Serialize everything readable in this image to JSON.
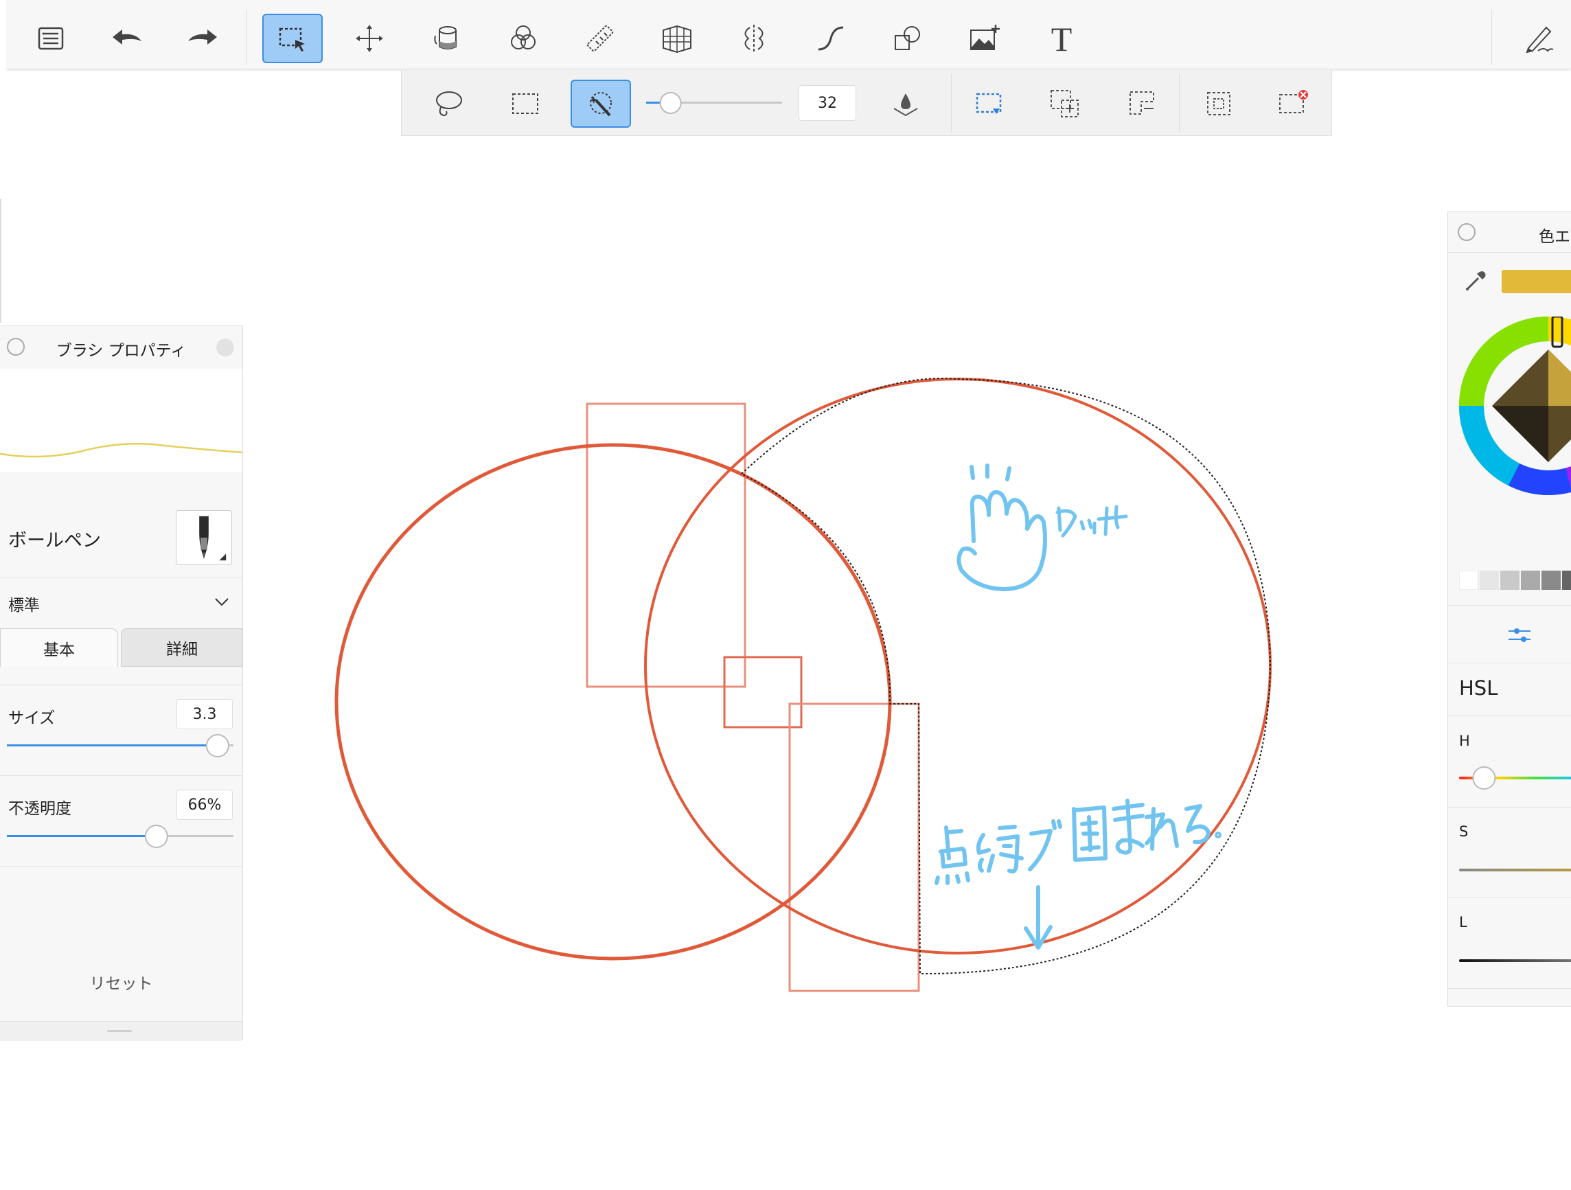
{
  "main_toolbar": {
    "tools": [
      {
        "id": "menu",
        "icon": "list-menu-icon"
      },
      {
        "id": "undo",
        "icon": "undo-arrow-icon"
      },
      {
        "id": "redo",
        "icon": "redo-arrow-icon"
      },
      {
        "id": "selection",
        "icon": "selection-tool-icon",
        "active": true
      },
      {
        "id": "transform",
        "icon": "move-arrows-icon"
      },
      {
        "id": "fill",
        "icon": "paint-bucket-icon"
      },
      {
        "id": "blend",
        "icon": "color-mix-circles-icon"
      },
      {
        "id": "ruler",
        "icon": "ruler-icon"
      },
      {
        "id": "perspective",
        "icon": "perspective-grid-icon"
      },
      {
        "id": "symmetry",
        "icon": "symmetry-icon"
      },
      {
        "id": "stroke",
        "icon": "curve-stroke-icon"
      },
      {
        "id": "shapes",
        "icon": "shapes-icon"
      },
      {
        "id": "image",
        "icon": "add-image-icon"
      },
      {
        "id": "text",
        "icon": "text-tool-icon",
        "glyph": "T"
      },
      {
        "id": "pen",
        "icon": "pen-settings-icon"
      }
    ]
  },
  "sub_toolbar": {
    "tools": [
      {
        "id": "lasso",
        "icon": "lasso-icon"
      },
      {
        "id": "rect-select",
        "icon": "rectangle-select-icon"
      },
      {
        "id": "magic-wand",
        "icon": "magic-wand-icon",
        "active": true
      },
      {
        "id": "fill-opacity",
        "icon": "droplet-icon"
      },
      {
        "id": "select-new",
        "icon": "new-selection-icon"
      },
      {
        "id": "select-add",
        "icon": "add-selection-icon"
      },
      {
        "id": "select-subtract",
        "icon": "subtract-selection-icon"
      },
      {
        "id": "select-invert",
        "icon": "invert-selection-icon"
      },
      {
        "id": "select-clear",
        "icon": "clear-selection-icon"
      }
    ],
    "tolerance": {
      "value": "32",
      "level": 0.18
    }
  },
  "brush_panel": {
    "title": "ブラシ プロパティ",
    "brush_name": "ボールペン",
    "preset": "標準",
    "tabs": [
      "基本",
      "詳細"
    ],
    "size": {
      "label": "サイズ",
      "value": "3.3",
      "level": 0.93
    },
    "opacity": {
      "label": "不透明度",
      "value": "66%",
      "level": 0.66
    },
    "reset": "リセット",
    "preview_stroke_color": "#e6cf5a"
  },
  "color_panel": {
    "title": "色エデ",
    "current_color": "#e3b93a",
    "mode": "HSL",
    "channels": [
      "H",
      "S",
      "L"
    ],
    "hue_level": 0.13
  },
  "canvas": {
    "stroke_color": "#e05a3a",
    "annotation_color": "#72c4f0",
    "annotations": [
      "タッチ",
      "点線で囲まれる"
    ]
  }
}
